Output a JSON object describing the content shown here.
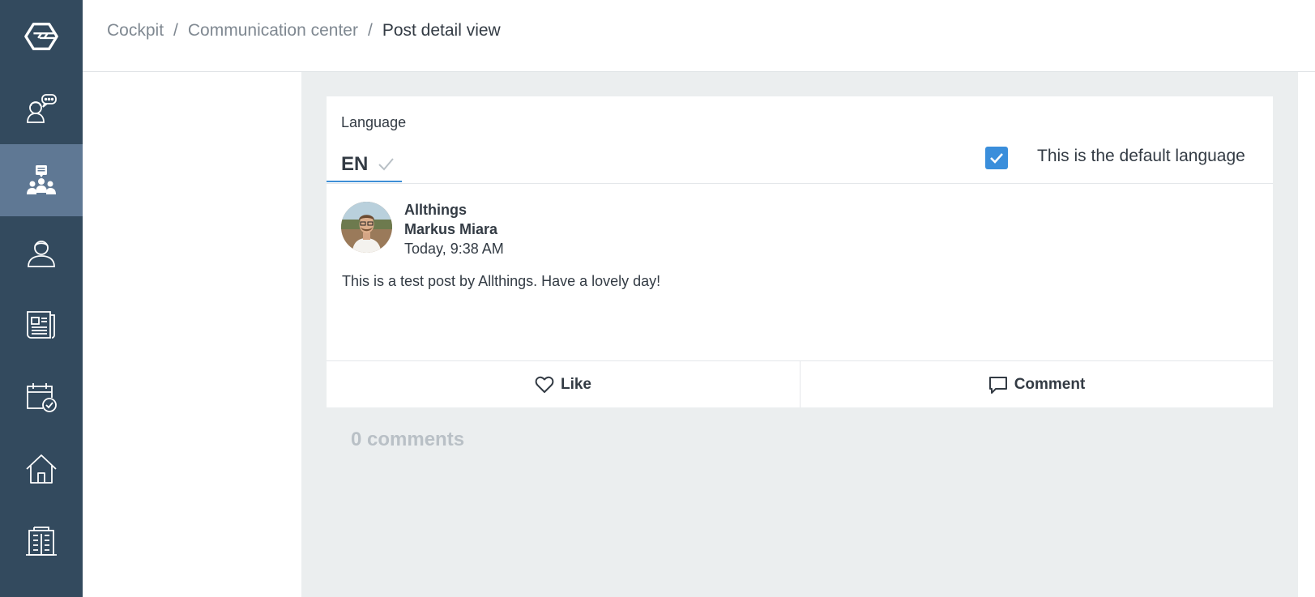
{
  "sidebar": {
    "items": [
      {
        "icon": "app-logo-icon"
      },
      {
        "icon": "support-chat-icon"
      },
      {
        "icon": "community-icon",
        "active": true
      },
      {
        "icon": "user-icon"
      },
      {
        "icon": "news-icon"
      },
      {
        "icon": "calendar-check-icon"
      },
      {
        "icon": "home-icon"
      },
      {
        "icon": "building-icon"
      }
    ],
    "bg_color": "#334a5e",
    "active_color": "#5f7894"
  },
  "breadcrumb": {
    "items": [
      "Cockpit",
      "Communication center"
    ],
    "separator": "/",
    "current": "Post detail view"
  },
  "language": {
    "label": "Language",
    "tab_code": "EN",
    "default_checked": true,
    "default_label": "This is the default language"
  },
  "post": {
    "organization": "Allthings",
    "author": "Markus Miara",
    "timestamp": "Today, 9:38 AM",
    "text": "This is a test post by Allthings. Have a lovely day!"
  },
  "actions": {
    "like_label": "Like",
    "comment_label": "Comment"
  },
  "comments": {
    "count_label": "0 comments"
  },
  "colors": {
    "accent": "#3a8edb",
    "content_bg": "#ebeeef"
  }
}
